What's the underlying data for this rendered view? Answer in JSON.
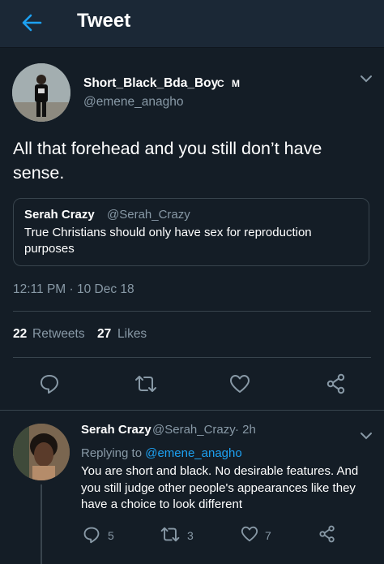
{
  "header": {
    "title": "Tweet"
  },
  "tweet": {
    "name": "Short_Black_Bda_Boy",
    "badge": "C M",
    "handle": "@emene_anagho",
    "text": "All that forehead and you still don’t have sense.",
    "quote": {
      "name": "Serah Crazy",
      "handle": "@Serah_Crazy",
      "text": "True Christians should only have sex for reproduction purposes"
    },
    "timestamp": "12:11 PM · 10 Dec 18",
    "retweets_count": "22",
    "retweets_label": "Retweets",
    "likes_count": "27",
    "likes_label": "Likes",
    "actions": [
      "reply-icon",
      "retweet-icon",
      "like-icon",
      "share-icon"
    ]
  },
  "reply": {
    "name": "Serah Crazy",
    "handle": "@Serah_Crazy",
    "time": "· 2h",
    "replying_prefix": "Replying to ",
    "replying_to": "@emene_anagho",
    "text": "You are short and black. No desirable features. And you still judge other people's appearances like they have a choice to look different",
    "reply_count": "5",
    "retweet_count": "3",
    "like_count": "7"
  },
  "colors": {
    "background": "#141d26",
    "accent": "#1da1f2",
    "muted": "#8899a6",
    "divider": "#38444d"
  }
}
